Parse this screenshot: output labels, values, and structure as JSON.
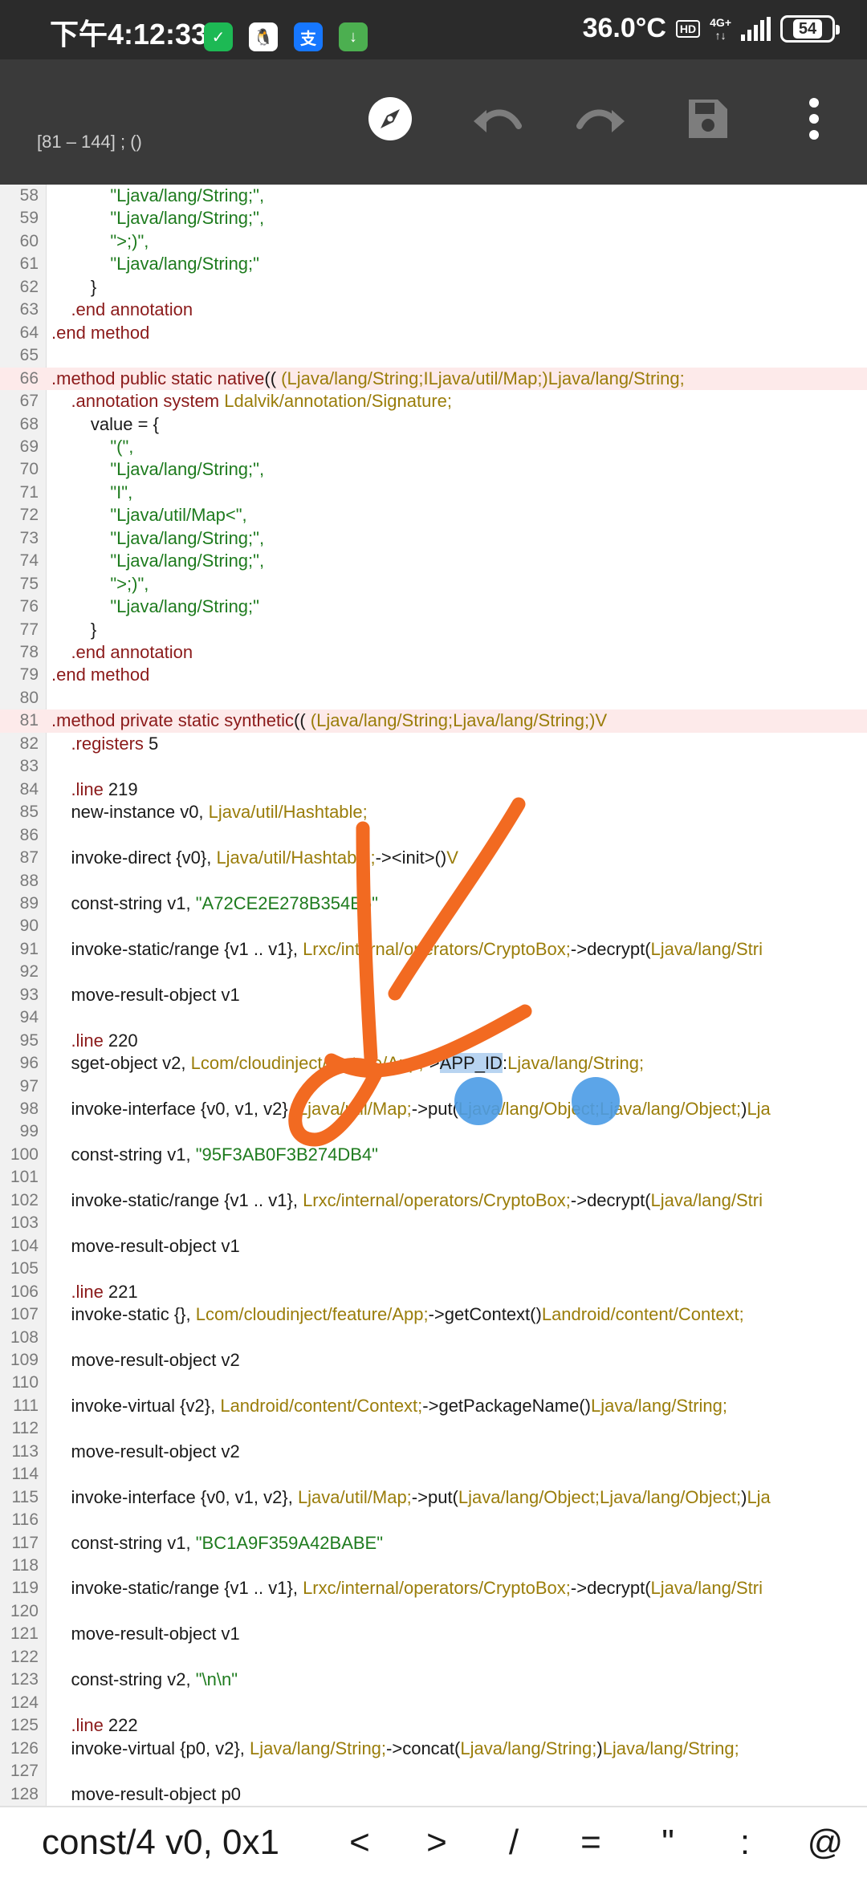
{
  "status_bar": {
    "time": "下午4:12:33",
    "temperature": "36.0°C",
    "hd": "HD",
    "network_top": "4G+",
    "network_bottom": "↑↓",
    "battery": "54",
    "app_icons": [
      {
        "name": "shield-app-icon",
        "color": "#1db954",
        "glyph": "✓"
      },
      {
        "name": "qq-app-icon",
        "color": "#ffffff",
        "glyph": "🐧"
      },
      {
        "name": "alipay-app-icon",
        "color": "#1677ff",
        "glyph": "支"
      },
      {
        "name": "download-app-icon",
        "color": "#4caf50",
        "glyph": "↓"
      }
    ]
  },
  "toolbar": {
    "range": "[81 – 144] ; ()",
    "buttons": [
      "compass-icon",
      "undo-icon",
      "redo-icon",
      "save-icon",
      "more-vertical-icon"
    ]
  },
  "code": {
    "first_line": 58,
    "highlight_lines": [
      66,
      81
    ],
    "selection": "APP_ID",
    "lines": [
      [
        [
          "str",
          "            \"Ljava/lang/String;\","
        ]
      ],
      [
        [
          "str",
          "            \"Ljava/lang/String;\","
        ]
      ],
      [
        [
          "str",
          "            \">;)\","
        ]
      ],
      [
        [
          "str",
          "            \"Ljava/lang/String;\""
        ]
      ],
      [
        [
          "plain",
          "        }"
        ]
      ],
      [
        [
          "kw",
          "    .end annotation"
        ]
      ],
      [
        [
          "kw",
          ".end method"
        ]
      ],
      [],
      [
        [
          "kw",
          ".method public static native"
        ],
        [
          "plain",
          "(( "
        ],
        [
          "sig",
          "(Ljava/lang/String;ILjava/util/Map;)Ljava/lang/String;"
        ]
      ],
      [
        [
          "kw",
          "    .annotation system "
        ],
        [
          "sig",
          "Ldalvik/annotation/Signature;"
        ]
      ],
      [
        [
          "plain",
          "        value = {"
        ]
      ],
      [
        [
          "str",
          "            \"(\","
        ]
      ],
      [
        [
          "str",
          "            \"Ljava/lang/String;\","
        ]
      ],
      [
        [
          "str",
          "            \"I\","
        ]
      ],
      [
        [
          "str",
          "            \"Ljava/util/Map<\","
        ]
      ],
      [
        [
          "str",
          "            \"Ljava/lang/String;\","
        ]
      ],
      [
        [
          "str",
          "            \"Ljava/lang/String;\","
        ]
      ],
      [
        [
          "str",
          "            \">;)\","
        ]
      ],
      [
        [
          "str",
          "            \"Ljava/lang/String;\""
        ]
      ],
      [
        [
          "plain",
          "        }"
        ]
      ],
      [
        [
          "kw",
          "    .end annotation"
        ]
      ],
      [
        [
          "kw",
          ".end method"
        ]
      ],
      [],
      [
        [
          "kw",
          ".method private static synthetic"
        ],
        [
          "plain",
          "(( "
        ],
        [
          "sig",
          "(Ljava/lang/String;Ljava/lang/String;)V"
        ]
      ],
      [
        [
          "kw",
          "    .registers "
        ],
        [
          "plain",
          "5"
        ]
      ],
      [],
      [
        [
          "kw",
          "    .line "
        ],
        [
          "plain",
          "219"
        ]
      ],
      [
        [
          "plain",
          "    new-instance v0, "
        ],
        [
          "sig",
          "Ljava/util/Hashtable;"
        ]
      ],
      [],
      [
        [
          "plain",
          "    invoke-direct {v0}, "
        ],
        [
          "sig",
          "Ljava/util/Hashtable;"
        ],
        [
          "plain",
          "-><init>()"
        ],
        [
          "sig",
          "V"
        ]
      ],
      [],
      [
        [
          "plain",
          "    const-string v1, "
        ],
        [
          "str",
          "\"A72CE2E278B354E6\""
        ]
      ],
      [],
      [
        [
          "plain",
          "    invoke-static/range {v1 .. v1}, "
        ],
        [
          "sig",
          "Lrxc/internal/operators/CryptoBox;"
        ],
        [
          "plain",
          "->decrypt("
        ],
        [
          "sig",
          "Ljava/lang/Stri"
        ]
      ],
      [],
      [
        [
          "plain",
          "    move-result-object v1"
        ]
      ],
      [],
      [
        [
          "kw",
          "    .line "
        ],
        [
          "plain",
          "220"
        ]
      ],
      [
        [
          "plain",
          "    sget-object v2, "
        ],
        [
          "sig",
          "Lcom/cloudinject/feature/App;"
        ],
        [
          "plain",
          "->"
        ],
        [
          "sel",
          "APP_ID"
        ],
        [
          "plain",
          ":"
        ],
        [
          "sig",
          "Ljava/lang/String;"
        ]
      ],
      [],
      [
        [
          "plain",
          "    invoke-interface {v0, v1, v2}, "
        ],
        [
          "sig",
          "Ljava/util/Map;"
        ],
        [
          "plain",
          "->put("
        ],
        [
          "sig",
          "Ljava/lang/Object;Ljava/lang/Object;"
        ],
        [
          "plain",
          ")"
        ],
        [
          "sig",
          "Lja"
        ]
      ],
      [],
      [
        [
          "plain",
          "    const-string v1, "
        ],
        [
          "str",
          "\"95F3AB0F3B274DB4\""
        ]
      ],
      [],
      [
        [
          "plain",
          "    invoke-static/range {v1 .. v1}, "
        ],
        [
          "sig",
          "Lrxc/internal/operators/CryptoBox;"
        ],
        [
          "plain",
          "->decrypt("
        ],
        [
          "sig",
          "Ljava/lang/Stri"
        ]
      ],
      [],
      [
        [
          "plain",
          "    move-result-object v1"
        ]
      ],
      [],
      [
        [
          "kw",
          "    .line "
        ],
        [
          "plain",
          "221"
        ]
      ],
      [
        [
          "plain",
          "    invoke-static {}, "
        ],
        [
          "sig",
          "Lcom/cloudinject/feature/App;"
        ],
        [
          "plain",
          "->getContext()"
        ],
        [
          "sig",
          "Landroid/content/Context;"
        ]
      ],
      [],
      [
        [
          "plain",
          "    move-result-object v2"
        ]
      ],
      [],
      [
        [
          "plain",
          "    invoke-virtual {v2}, "
        ],
        [
          "sig",
          "Landroid/content/Context;"
        ],
        [
          "plain",
          "->getPackageName()"
        ],
        [
          "sig",
          "Ljava/lang/String;"
        ]
      ],
      [],
      [
        [
          "plain",
          "    move-result-object v2"
        ]
      ],
      [],
      [
        [
          "plain",
          "    invoke-interface {v0, v1, v2}, "
        ],
        [
          "sig",
          "Ljava/util/Map;"
        ],
        [
          "plain",
          "->put("
        ],
        [
          "sig",
          "Ljava/lang/Object;Ljava/lang/Object;"
        ],
        [
          "plain",
          ")"
        ],
        [
          "sig",
          "Lja"
        ]
      ],
      [],
      [
        [
          "plain",
          "    const-string v1, "
        ],
        [
          "str",
          "\"BC1A9F359A42BABE\""
        ]
      ],
      [],
      [
        [
          "plain",
          "    invoke-static/range {v1 .. v1}, "
        ],
        [
          "sig",
          "Lrxc/internal/operators/CryptoBox;"
        ],
        [
          "plain",
          "->decrypt("
        ],
        [
          "sig",
          "Ljava/lang/Stri"
        ]
      ],
      [],
      [
        [
          "plain",
          "    move-result-object v1"
        ]
      ],
      [],
      [
        [
          "plain",
          "    const-string v2, "
        ],
        [
          "str",
          "\"\\n\\n\""
        ]
      ],
      [],
      [
        [
          "kw",
          "    .line "
        ],
        [
          "plain",
          "222"
        ]
      ],
      [
        [
          "plain",
          "    invoke-virtual {p0, v2}, "
        ],
        [
          "sig",
          "Ljava/lang/String;"
        ],
        [
          "plain",
          "->concat("
        ],
        [
          "sig",
          "Ljava/lang/String;"
        ],
        [
          "plain",
          ")"
        ],
        [
          "sig",
          "Ljava/lang/String;"
        ]
      ],
      [],
      [
        [
          "plain",
          "    move-result-object p0"
        ]
      ]
    ]
  },
  "symbol_bar": {
    "items": [
      "const/4 v0, 0x1",
      "<",
      ">",
      "/",
      "=",
      "\"",
      ":",
      "@"
    ]
  },
  "colors": {
    "annotation_stroke": "#f26a21",
    "selection_handles": "#4a9be6"
  }
}
